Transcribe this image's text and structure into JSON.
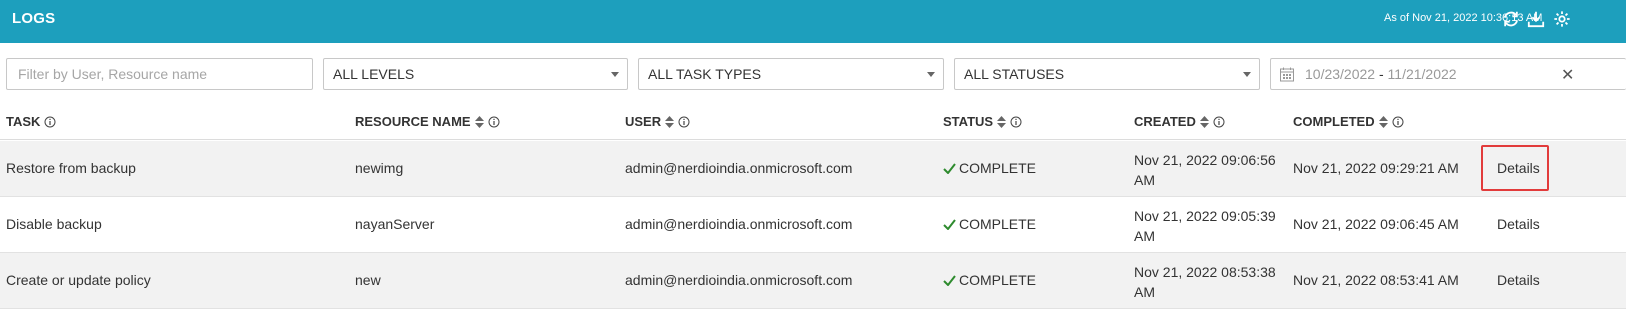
{
  "header": {
    "title": "LOGS",
    "as_of": "As of Nov 21, 2022 10:36:13 AM",
    "icons": [
      "refresh-icon",
      "download-icon",
      "settings-icon"
    ]
  },
  "filters": {
    "search_placeholder": "Filter by User, Resource name",
    "levels": "ALL LEVELS",
    "task_types": "ALL TASK TYPES",
    "statuses": "ALL STATUSES",
    "date_from": "10/23/2022",
    "date_sep": "-",
    "date_to": "11/21/2022"
  },
  "columns": [
    "TASK",
    "RESOURCE NAME",
    "USER",
    "STATUS",
    "CREATED",
    "COMPLETED"
  ],
  "rows": [
    {
      "task": "Restore from backup",
      "resource": "newimg",
      "user": "admin@nerdioindia.onmicrosoft.com",
      "status": "COMPLETE",
      "created": "Nov 21, 2022 09:06:56 AM",
      "completed": "Nov 21, 2022 09:29:21 AM",
      "action": "Details"
    },
    {
      "task": "Disable backup",
      "resource": "nayanServer",
      "user": "admin@nerdioindia.onmicrosoft.com",
      "status": "COMPLETE",
      "created": "Nov 21, 2022 09:05:39 AM",
      "completed": "Nov 21, 2022 09:06:45 AM",
      "action": "Details"
    },
    {
      "task": "Create or update policy",
      "resource": "new",
      "user": "admin@nerdioindia.onmicrosoft.com",
      "status": "COMPLETE",
      "created": "Nov 21, 2022 08:53:38 AM",
      "completed": "Nov 21, 2022 08:53:41 AM",
      "action": "Details"
    }
  ],
  "colors": {
    "header_bg": "#1d9fbd",
    "status_ok": "#2e8b2e",
    "highlight": "#e23b3b"
  }
}
